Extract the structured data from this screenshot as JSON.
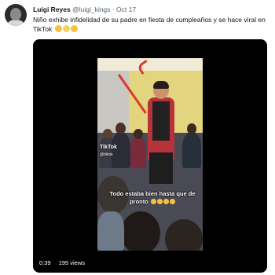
{
  "tweet": {
    "author": {
      "display_name": "Luigi Reyes",
      "handle": "@luigi_kings",
      "separator": "·",
      "date": "Oct 17"
    },
    "text": "Niño exhibe infidelidad de su padre en fiesta de cumpleaños y se hace viral en TikTok",
    "text_emojis": [
      "face-with-open-mouth",
      "person-shrugging",
      "face-with-tears"
    ],
    "media": {
      "type": "video",
      "overlay": {
        "watermark": "TikTok",
        "watermark_handle": "@tiktok",
        "caption": "Todo estaba bien hasta que de pronto",
        "caption_emojis": [
          "laughing",
          "laughing",
          "laughing",
          "laughing"
        ]
      },
      "duration": "0:39",
      "views": "195 views"
    }
  },
  "colors": {
    "background": "#ffffff",
    "text_primary": "#0f1419",
    "text_secondary": "#536471",
    "media_background": "#000000"
  }
}
